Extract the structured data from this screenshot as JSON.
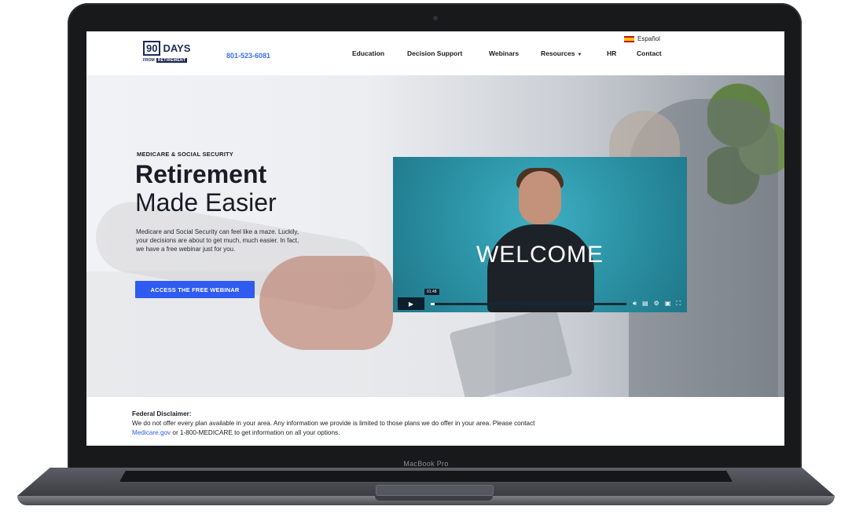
{
  "device": {
    "label": "MacBook Pro"
  },
  "header": {
    "logo": {
      "number": "90",
      "word": "DAYS",
      "from": "FROM",
      "sub": "RETIREMENT"
    },
    "phone": "801-523-6081",
    "language": "Español",
    "nav": [
      "Education",
      "Decision Support",
      "Webinars",
      "Resources",
      "HR",
      "Contact"
    ]
  },
  "hero": {
    "eyebrow": "MEDICARE & SOCIAL SECURITY",
    "heading_strong": "Retirement",
    "heading_light": "Made Easier",
    "lede": "Medicare and Social Security can feel like a maze. Luckily, your decisions are about to get much, much easier. In fact, we have a free webinar just for you.",
    "cta_label": "ACCESS THE FREE WEBINAR"
  },
  "video": {
    "overlay_text": "WELCOME",
    "time": "01:48",
    "progress": 0.02,
    "controls": [
      "volume-icon",
      "captions-icon",
      "settings-icon",
      "pip-icon",
      "fullscreen-icon"
    ]
  },
  "disclaimer": {
    "title": "Federal Disclaimer:",
    "body": "We do not offer every plan available in your area. Any information we provide is limited to those plans we do offer in your area. Please contact",
    "link": "Medicare.gov",
    "tail": " or 1-800-MEDICARE to get information on all your options."
  },
  "colors": {
    "brand_navy": "#1e2a55",
    "accent_blue": "#2f5bf0",
    "video_teal": "#2d95a8"
  }
}
